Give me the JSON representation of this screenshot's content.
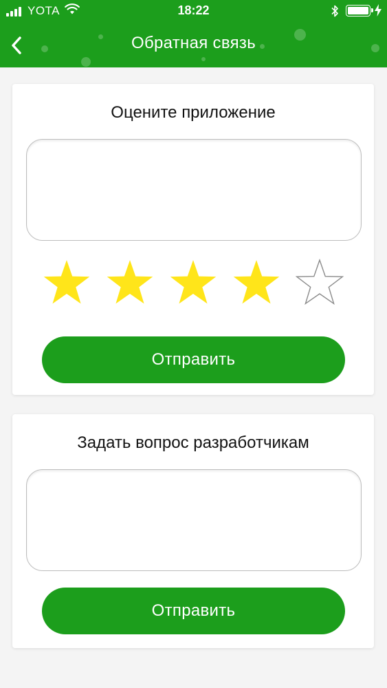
{
  "status_bar": {
    "carrier": "YOTA",
    "time": "18:22",
    "battery_level": 1.0
  },
  "nav": {
    "title": "Обратная связь",
    "back_icon": "chevron-left-icon"
  },
  "rating_section": {
    "title": "Оцените приложение",
    "comment_value": "",
    "rating": 4,
    "max_rating": 5,
    "submit_label": "Отправить"
  },
  "question_section": {
    "title": "Задать вопрос разработчикам",
    "question_value": "",
    "submit_label": "Отправить"
  },
  "colors": {
    "brand_green": "#1c9e1c",
    "star_filled": "#ffe51a",
    "star_empty_stroke": "#8a8a8a",
    "background": "#f4f4f4"
  }
}
